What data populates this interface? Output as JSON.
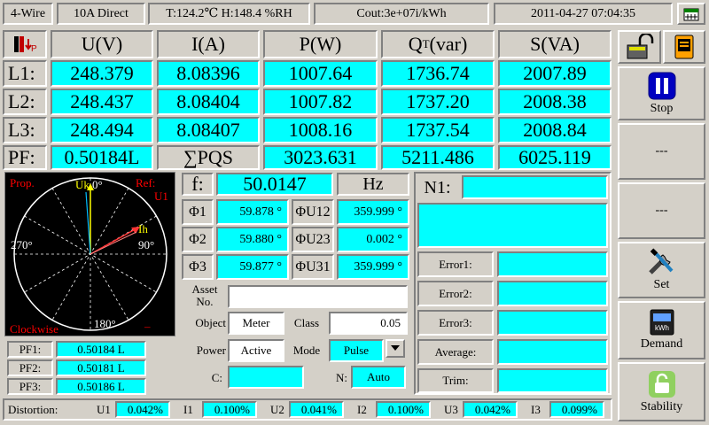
{
  "status": {
    "wiring": "4-Wire",
    "current_mode": "10A Direct",
    "temp_humidity": "T:124.2℃  H:148.4 %RH",
    "constant": "Cout:3e+07i/kWh",
    "datetime": "2011-04-27 07:04:35"
  },
  "table": {
    "headers": [
      "U(V)",
      "I(A)",
      "P(W)",
      "(var)",
      "S(VA)"
    ],
    "q_letter": "Q",
    "q_sub": "T",
    "rows": [
      {
        "label": "L1:",
        "values": [
          "248.379",
          "8.08396",
          "1007.64",
          "1736.74",
          "2007.89"
        ]
      },
      {
        "label": "L2:",
        "values": [
          "248.437",
          "8.08404",
          "1007.82",
          "1737.20",
          "2008.38"
        ]
      },
      {
        "label": "L3:",
        "values": [
          "248.494",
          "8.08407",
          "1008.16",
          "1737.54",
          "2008.84"
        ]
      }
    ],
    "pf_label": "PF:",
    "pf_value": "0.50184L",
    "sum_label": "∑PQS",
    "sum_values": [
      "3023.631",
      "5211.486",
      "6025.119"
    ]
  },
  "phasor": {
    "prop": "Prop.",
    "ref": "Ref:",
    "ref_phase": "U1",
    "clockwise": "Clockwise",
    "deg0": "0°",
    "deg90": "90°",
    "deg180": "180°",
    "deg270": "270°",
    "u_label": "Uk",
    "i_label": "Ih",
    "minus": "–",
    "colors": {
      "voltage": "#ffff00",
      "current": "#ff3333",
      "circle": "#ffffff",
      "text": "#ff0000"
    }
  },
  "pf_list": [
    {
      "label": "PF1:",
      "value": "0.50184 L"
    },
    {
      "label": "PF2:",
      "value": "0.50181 L"
    },
    {
      "label": "PF3:",
      "value": "0.50186 L"
    }
  ],
  "freq": {
    "label": "f:",
    "value": "50.0147",
    "unit": "Hz"
  },
  "phases": [
    {
      "label": "Φ1",
      "value": "59.878 °",
      "label2": "ΦU12",
      "value2": "359.999 °"
    },
    {
      "label": "Φ2",
      "value": "59.880 °",
      "label2": "ΦU23",
      "value2": "0.002 °"
    },
    {
      "label": "Φ3",
      "value": "59.877 °",
      "label2": "ΦU31",
      "value2": "359.999 °"
    }
  ],
  "form": {
    "asset_label_1": "Asset",
    "asset_label_2": "No.",
    "asset_value": "",
    "object_label": "Object",
    "object_value": "Meter",
    "class_label": "Class",
    "class_value": "0.05",
    "power_label": "Power",
    "power_value": "Active",
    "mode_label": "Mode",
    "mode_value": "Pulse",
    "c_label": "C:",
    "c_value": "",
    "n_label": "N:",
    "n_value": "Auto"
  },
  "errors": {
    "n1_label": "N1:",
    "n1_value": "",
    "rows": [
      {
        "label": "Error1:",
        "value": ""
      },
      {
        "label": "Error2:",
        "value": ""
      },
      {
        "label": "Error3:",
        "value": ""
      },
      {
        "label": "Average:",
        "value": ""
      },
      {
        "label": "Trim:",
        "value": ""
      }
    ]
  },
  "distortion": {
    "label": "Distortion:",
    "items": [
      {
        "label": "U1",
        "value": "0.042%"
      },
      {
        "label": "I1",
        "value": "0.100%"
      },
      {
        "label": "U2",
        "value": "0.041%"
      },
      {
        "label": "I2",
        "value": "0.100%"
      },
      {
        "label": "U3",
        "value": "0.042%"
      },
      {
        "label": "I3",
        "value": "0.099%"
      }
    ]
  },
  "sidebar": {
    "stop": "Stop",
    "blank1": "---",
    "blank2": "---",
    "set": "Set",
    "demand": "Demand",
    "stability": "Stability"
  }
}
